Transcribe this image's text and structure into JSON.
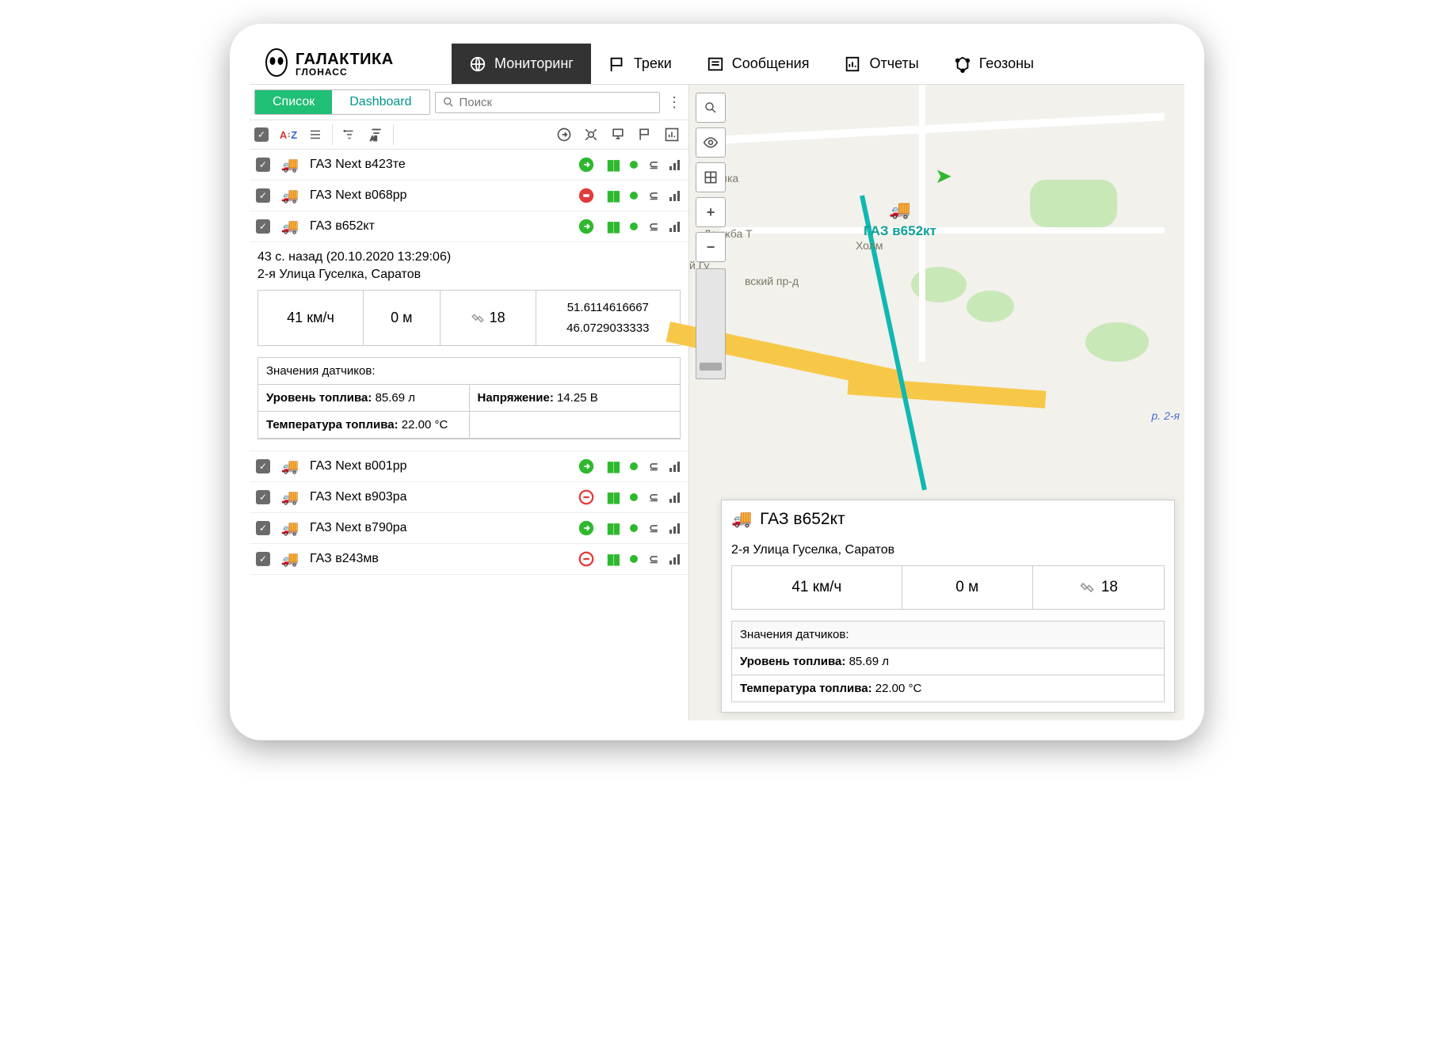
{
  "brand": {
    "line1": "ГАЛАКТИКА",
    "line2": "ГЛОНАСС"
  },
  "nav": {
    "monitoring": "Мониторинг",
    "tracks": "Треки",
    "messages": "Сообщения",
    "reports": "Отчеты",
    "geofences": "Геозоны"
  },
  "subtabs": {
    "list": "Список",
    "dashboard": "Dashboard"
  },
  "search": {
    "placeholder": "Поиск"
  },
  "toolbar": {
    "sort": "A↕Z",
    "all": "All"
  },
  "vehicles": [
    {
      "name": "ГАЗ Next в423те",
      "status": "go"
    },
    {
      "name": "ГАЗ Next в068рр",
      "status": "stop-solid"
    },
    {
      "name": "ГАЗ в652кт",
      "status": "go"
    },
    {
      "name": "ГАЗ Next в001рр",
      "status": "go"
    },
    {
      "name": "ГАЗ Next в903ра",
      "status": "stop-outline"
    },
    {
      "name": "ГАЗ Next в790ра",
      "status": "go"
    },
    {
      "name": "ГАЗ в243мв",
      "status": "stop-outline"
    }
  ],
  "detail": {
    "ago": "43 с. назад (20.10.2020 13:29:06)",
    "address": "2-я Улица Гуселка, Саратов",
    "speed": "41 км/ч",
    "altitude": "0 м",
    "sat_count": "18",
    "lat": "51.6114616667",
    "lon": "46.0729033333",
    "sensors_header": "Значения датчиков:",
    "fuel_label": "Уровень топлива:",
    "fuel_value": "85.69 л",
    "voltage_label": "Напряжение:",
    "voltage_value": "14.25 В",
    "fueltemp_label": "Температура топлива:",
    "fueltemp_value": "22.00 °C"
  },
  "map": {
    "street1": "Гуселка",
    "street2": "Дружба Т",
    "street3": "Холм",
    "street4": "вский пр-д",
    "street5": "й Гу",
    "river": "р. 2-я",
    "selected_vehicle": "ГАЗ в652кт"
  },
  "popup": {
    "title": "ГАЗ в652кт",
    "address": "2-я Улица Гуселка, Саратов",
    "speed": "41 км/ч",
    "altitude": "0 м",
    "sat_count": "18",
    "sensors_header": "Значения датчиков:",
    "fuel_label": "Уровень топлива:",
    "fuel_value": "85.69 л",
    "fueltemp_label": "Температура топлива:",
    "fueltemp_value": "22.00 °C"
  }
}
